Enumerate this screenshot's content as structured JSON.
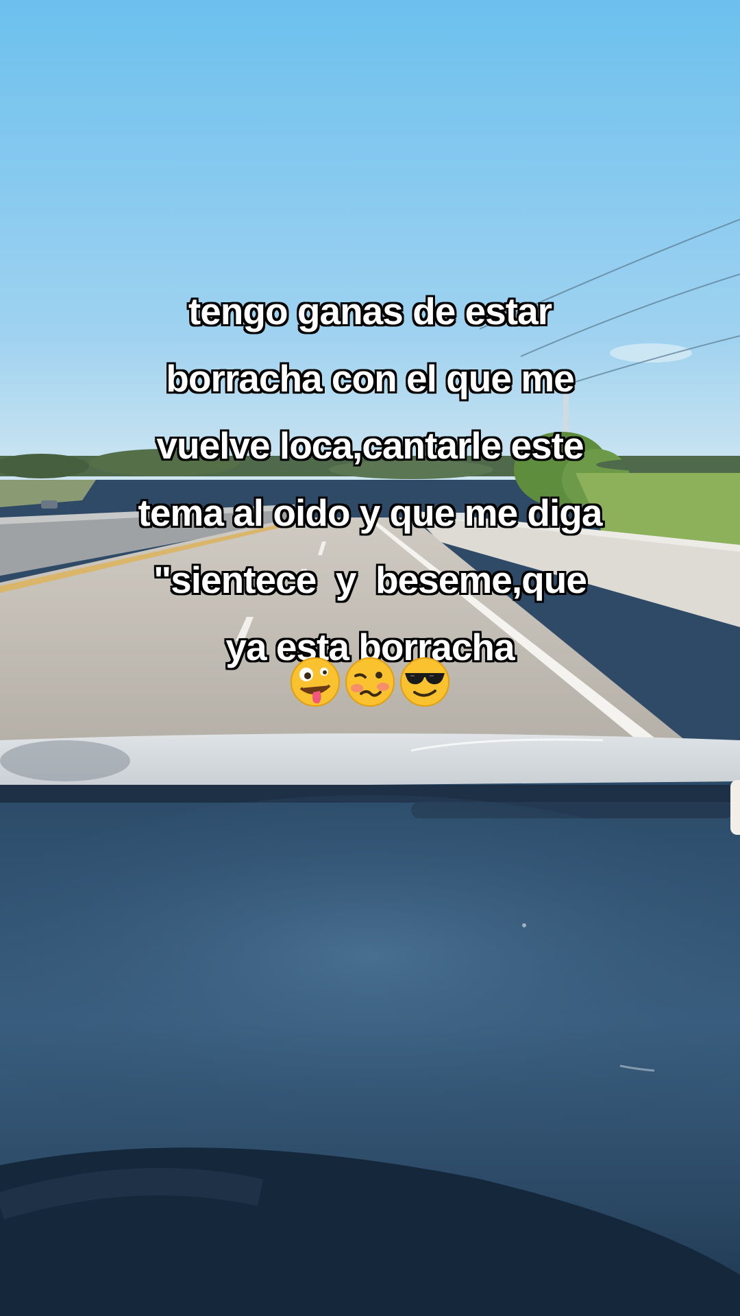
{
  "caption": {
    "lines": [
      "tengo ganas de estar",
      "borracha con el que me",
      "vuelve loca,cantarle este",
      "tema al oido y que me diga",
      "\"sientece  y  beseme,que",
      "ya esta borracha"
    ]
  },
  "emojis": [
    "zany-face-emoji",
    "woozy-face-emoji",
    "sunglasses-face-emoji"
  ],
  "colors": {
    "sky_top": "#6fc2ee",
    "sky_horizon": "#c8e4f2",
    "road": "#bdb9b1",
    "grass": "#8fb060",
    "dashboard": "#2e4a66",
    "caption_text": "#ffffff",
    "caption_outline": "#000000"
  }
}
